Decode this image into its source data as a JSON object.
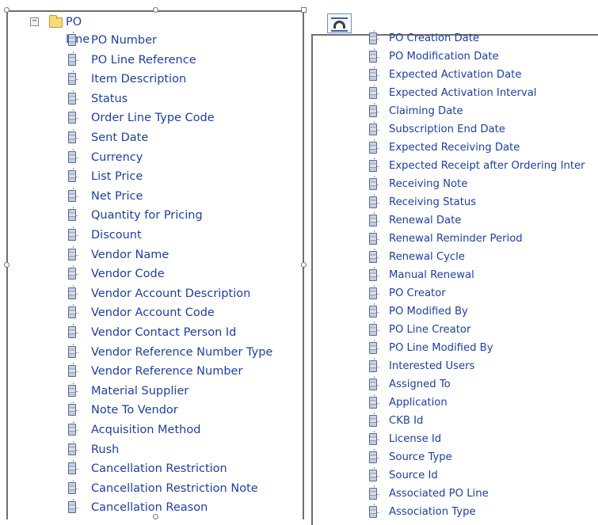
{
  "tree": {
    "root_label": "PO Line",
    "expander_symbol": "⊟",
    "left_fields": [
      "PO Number",
      "PO Line Reference",
      "Item Description",
      "Status",
      "Order Line Type Code",
      "Sent Date",
      "Currency",
      "List Price",
      "Net Price",
      "Quantity for Pricing",
      "Discount",
      "Vendor Name",
      "Vendor Code",
      "Vendor Account Description",
      "Vendor Account Code",
      "Vendor Contact Person Id",
      "Vendor Reference Number Type",
      "Vendor Reference Number",
      "Material Supplier",
      "Note To Vendor",
      "Acquisition Method",
      "Rush",
      "Cancellation Restriction",
      "Cancellation Restriction Note",
      "Cancellation Reason"
    ],
    "right_fields": [
      "PO Creation Date",
      "PO Modification Date",
      "Expected Activation Date",
      "Expected Activation Interval",
      "Claiming Date",
      "Subscription End Date",
      "Expected Receiving Date",
      "Expected Receipt after Ordering Inter",
      "Receiving Note",
      "Receiving Status",
      "Renewal Date",
      "Renewal Reminder Period",
      "Renewal Cycle",
      "Manual Renewal",
      "PO Creator",
      "PO Modified By",
      "PO Line Creator",
      "PO Line Modified By",
      "Interested Users",
      "Assigned To",
      "Application",
      "CKB Id",
      "License Id",
      "Source Type",
      "Source Id",
      "Associated PO Line",
      "Association Type"
    ]
  },
  "icons": {
    "folder": "folder-icon",
    "field": "field-icon",
    "wrap": "text-wrap-icon"
  },
  "colors": {
    "label_text": "#1d3fa3",
    "frame_border": "#6f6f6f",
    "folder_fill": "#f6dd77"
  }
}
